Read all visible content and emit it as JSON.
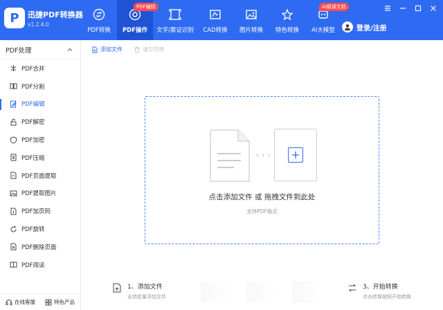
{
  "app": {
    "name": "迅捷PDF转换器",
    "version": "v1.2.4.0",
    "logo_glyph": "P"
  },
  "nav": {
    "items": [
      {
        "label": "PDF转换",
        "icon": "convert-icon"
      },
      {
        "label": "PDF操作",
        "icon": "target-icon",
        "badge": "PDF编辑",
        "active": true
      },
      {
        "label": "文字/票证识别",
        "icon": "scan-icon"
      },
      {
        "label": "CAD转换",
        "icon": "cad-icon"
      },
      {
        "label": "图片转换",
        "icon": "image-icon"
      },
      {
        "label": "特色转换",
        "icon": "star-icon"
      },
      {
        "label": "AI大模型",
        "icon": "ai-icon",
        "badge": "AI解读文档"
      }
    ]
  },
  "user": {
    "login_label": "登录/注册"
  },
  "sidebar": {
    "header": "PDF处理",
    "items": [
      {
        "label": "PDF合并",
        "icon": "merge-icon"
      },
      {
        "label": "PDF分割",
        "icon": "split-icon"
      },
      {
        "label": "PDF编辑",
        "icon": "edit-icon",
        "active": true
      },
      {
        "label": "PDF解密",
        "icon": "unlock-icon"
      },
      {
        "label": "PDF加密",
        "icon": "shield-icon"
      },
      {
        "label": "PDF压缩",
        "icon": "compress-icon"
      },
      {
        "label": "PDF页面提取",
        "icon": "page-extract-icon"
      },
      {
        "label": "PDF提取图片",
        "icon": "image-extract-icon"
      },
      {
        "label": "PDF加页码",
        "icon": "page-number-icon"
      },
      {
        "label": "PDF旋转",
        "icon": "rotate-icon"
      },
      {
        "label": "PDF删除页面",
        "icon": "delete-page-icon"
      },
      {
        "label": "PDF阅读",
        "icon": "book-icon"
      }
    ],
    "bottom": {
      "service_label": "在线客服",
      "products_label": "特色产品"
    }
  },
  "toolbar": {
    "add_label": "添加文件",
    "clear_label": "清空列表"
  },
  "dropzone": {
    "main_text": "点击添加文件 或 拖拽文件到此处",
    "sub_text": "支持PDF格式",
    "arrows": "› › ›"
  },
  "steps": [
    {
      "title": "1、添加文件",
      "sub": "支持批量添加文件"
    },
    {
      "title": "3、开始转换",
      "sub": "点击转换按钮开始转换"
    }
  ],
  "colors": {
    "primary": "#2e6bf2",
    "active_nav": "#1f53d6",
    "badge": "#ff4d4f",
    "dashed_border": "#4a84f6"
  }
}
